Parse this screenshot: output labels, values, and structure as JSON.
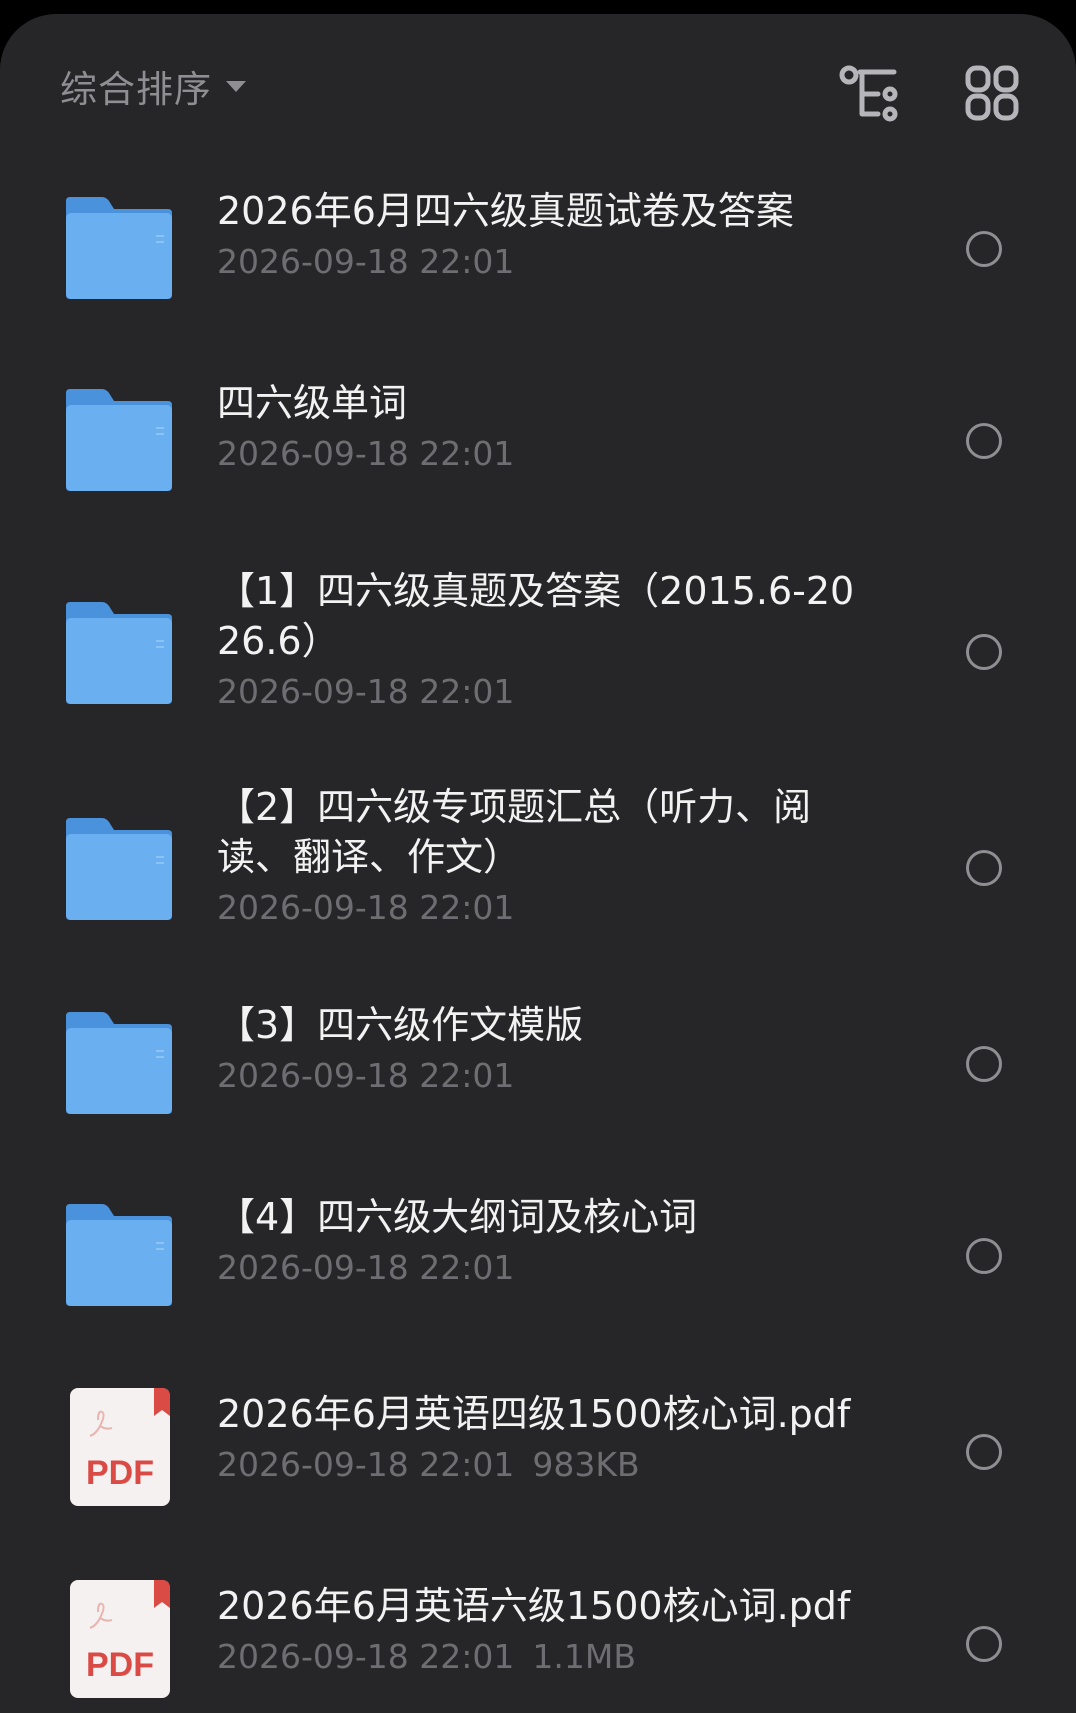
{
  "toolbar": {
    "sort_label": "综合排序",
    "sort_arrow_icon": "caret-down-icon",
    "tree_view_icon": "tree-view-icon",
    "grid_view_icon": "grid-view-icon"
  },
  "colors": {
    "background": "#262628",
    "folder": "#6aaff0",
    "pdf_red": "#d94b44",
    "title_text": "#f2f2f2",
    "meta_text": "#6e6e72"
  },
  "files": [
    {
      "type": "folder",
      "icon": "folder-icon",
      "title": "2026年6月四六级真题试卷及答案",
      "date": "2026-09-18 22:01",
      "size": ""
    },
    {
      "type": "folder",
      "icon": "folder-icon",
      "title": "四六级单词",
      "date": "2026-09-18 22:01",
      "size": ""
    },
    {
      "type": "folder",
      "icon": "folder-icon",
      "title": "【1】四六级真题及答案（2015.6-2026.6）",
      "date": "2026-09-18 22:01",
      "size": ""
    },
    {
      "type": "folder",
      "icon": "folder-icon",
      "title": "【2】四六级专项题汇总（听力、阅读、翻译、作文）",
      "date": "2026-09-18 22:01",
      "size": ""
    },
    {
      "type": "folder",
      "icon": "folder-icon",
      "title": "【3】四六级作文模版",
      "date": "2026-09-18 22:01",
      "size": ""
    },
    {
      "type": "folder",
      "icon": "folder-icon",
      "title": "【4】四六级大纲词及核心词",
      "date": "2026-09-18 22:01",
      "size": ""
    },
    {
      "type": "pdf",
      "icon": "pdf-file-icon",
      "badge": "PDF",
      "title": "2026年6月英语四级1500核心词.pdf",
      "date": "2026-09-18 22:01",
      "size": "983KB"
    },
    {
      "type": "pdf",
      "icon": "pdf-file-icon",
      "badge": "PDF",
      "title": "2026年6月英语六级1500核心词.pdf",
      "date": "2026-09-18 22:01",
      "size": "1.1MB"
    }
  ]
}
